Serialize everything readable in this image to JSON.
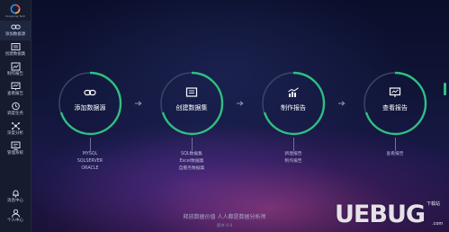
{
  "sidebar": {
    "logo_text": "Yonghong Tech",
    "items": [
      {
        "label": "添加数据源",
        "icon": "link-icon"
      },
      {
        "label": "创建数据集",
        "icon": "dataset-icon"
      },
      {
        "label": "制作报告",
        "icon": "chart-icon"
      },
      {
        "label": "查看报告",
        "icon": "report-view-icon"
      },
      {
        "label": "调度任务",
        "icon": "clock-icon"
      },
      {
        "label": "深度分析",
        "icon": "analysis-icon"
      },
      {
        "label": "管理系统",
        "icon": "manage-icon"
      }
    ],
    "bottom_items": [
      {
        "label": "消息中心",
        "icon": "bell-icon"
      },
      {
        "label": "个人中心",
        "icon": "user-icon"
      }
    ]
  },
  "flow": [
    {
      "title": "添加数据源",
      "icon": "link-icon",
      "subs": [
        "MYSQL",
        "SQLSERVER",
        "ORACLE"
      ]
    },
    {
      "title": "创建数据集",
      "icon": "dataset-icon",
      "subs": [
        "SQL数据集",
        "Excel数据集",
        "自服务数据集"
      ]
    },
    {
      "title": "制作报告",
      "icon": "chart-icon",
      "subs": [
        "新建报告",
        "制作报告"
      ]
    },
    {
      "title": "查看报告",
      "icon": "report-view-icon",
      "subs": [
        "查看报告"
      ]
    }
  ],
  "footer": {
    "slogan": "释放数据价值 人人都是数据分析师",
    "version": "版本 8.8"
  },
  "watermark": {
    "text": "UEBUG",
    "sub": "下载站",
    "domain": ".com"
  },
  "colors": {
    "accent": "#2fbf82",
    "ring_track": "#3b4466",
    "sidebar_bg": "#161b2e"
  }
}
